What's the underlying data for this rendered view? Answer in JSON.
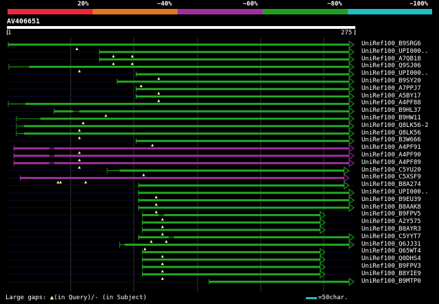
{
  "scale": {
    "labels": [
      "20%",
      "~40%",
      "~60%",
      "~80%",
      "~100%"
    ],
    "colors": [
      "#e8283c",
      "#e07820",
      "#a030a0",
      "#20a020",
      "#20c0c0"
    ]
  },
  "query": {
    "id": "AV406651",
    "start": "1",
    "end": "275"
  },
  "colors": {
    "green": "#22aa22",
    "purple": "#a030a0",
    "gap": "#22aa22",
    "triangle": "#ffffaa",
    "background": "#000000"
  },
  "hits": [
    {
      "label": "UniRef100_B9SRG6",
      "color": "green",
      "start": 0.5,
      "end": 275,
      "gaps": [
        55
      ]
    },
    {
      "label": "UniRef100_UPI000..",
      "color": "green",
      "start": 73,
      "end": 275,
      "gaps": [
        84,
        99
      ]
    },
    {
      "label": "UniRef100_A7QB18",
      "color": "green",
      "start": 73,
      "end": 275,
      "gaps": [
        84,
        99
      ]
    },
    {
      "label": "UniRef100_Q9SJ06",
      "color": "green",
      "start": 1,
      "end": 275,
      "thin": [
        [
          1,
          17
        ]
      ],
      "gaps": [
        57
      ]
    },
    {
      "label": "UniRef100_UPI000..",
      "color": "green",
      "start": 102,
      "end": 275,
      "gaps": [
        120
      ]
    },
    {
      "label": "UniRef100_B9SY20",
      "color": "green",
      "start": 87,
      "end": 275,
      "gaps": [
        106
      ]
    },
    {
      "label": "UniRef100_A7PPJ7",
      "color": "green",
      "start": 102,
      "end": 275,
      "gaps": [
        120
      ]
    },
    {
      "label": "UniRef100_A5BY17",
      "color": "green",
      "start": 102,
      "end": 275,
      "gaps": [
        120
      ]
    },
    {
      "label": "UniRef100_A4PF88",
      "color": "green",
      "start": 0.5,
      "end": 275,
      "thin": [
        [
          0.5,
          14
        ]
      ],
      "gaps": []
    },
    {
      "label": "UniRef100_B9HL37",
      "color": "green",
      "start": 37,
      "end": 275,
      "thin": [
        [
          52,
          57
        ]
      ],
      "gaps": [
        78
      ]
    },
    {
      "label": "UniRef100_B9HW11",
      "color": "green",
      "start": 7,
      "end": 275,
      "thin": [
        [
          7,
          26
        ]
      ],
      "gaps": [
        60
      ]
    },
    {
      "label": "UniRef100_Q8LK56-2",
      "color": "green",
      "start": 7,
      "end": 275,
      "thin": [
        [
          7,
          13
        ]
      ],
      "gaps": [
        57
      ]
    },
    {
      "label": "UniRef100_Q8LK56",
      "color": "green",
      "start": 7,
      "end": 275,
      "thin": [
        [
          7,
          13
        ]
      ],
      "gaps": [
        57
      ]
    },
    {
      "label": "UniRef100_B3W666",
      "color": "green",
      "start": 102,
      "end": 275,
      "gaps": [
        115
      ]
    },
    {
      "label": "UniRef100_A4PF91",
      "color": "purple",
      "start": 5,
      "end": 275,
      "thin": [
        [
          33,
          37
        ]
      ],
      "gaps": [
        57
      ]
    },
    {
      "label": "UniRef100_A4PF90",
      "color": "purple",
      "start": 5,
      "end": 275,
      "thin": [
        [
          33,
          37
        ]
      ],
      "gaps": [
        57
      ]
    },
    {
      "label": "UniRef100_A4PF89",
      "color": "purple",
      "start": 5,
      "end": 275,
      "thin": [
        [
          33,
          37
        ]
      ],
      "gaps": [
        57
      ]
    },
    {
      "label": "UniRef100_C5YU20",
      "color": "green",
      "start": 79,
      "end": 271,
      "thin": [
        [
          79,
          89
        ]
      ],
      "gaps": [
        108
      ]
    },
    {
      "label": "UniRef100_C5XSF9",
      "color": "purple",
      "start": 10,
      "end": 271,
      "gaps": [
        40,
        42,
        62
      ]
    },
    {
      "label": "UniRef100_B8A274",
      "color": "green",
      "start": 104,
      "end": 271,
      "gaps": []
    },
    {
      "label": "UniRef100_UPI000..",
      "color": "green",
      "start": 104,
      "end": 275,
      "gaps": [
        118
      ]
    },
    {
      "label": "UniRef100_B9EU39",
      "color": "green",
      "start": 104,
      "end": 275,
      "gaps": [
        118
      ]
    },
    {
      "label": "UniRef100_B8AAK8",
      "color": "green",
      "start": 104,
      "end": 275,
      "gaps": [
        118
      ]
    },
    {
      "label": "UniRef100_B9FPV5",
      "color": "green",
      "start": 107,
      "end": 252,
      "thin": [
        [
          120,
          124
        ]
      ],
      "gaps": [
        123
      ]
    },
    {
      "label": "UniRef100_A2Y575",
      "color": "green",
      "start": 107,
      "end": 252,
      "gaps": [
        123
      ]
    },
    {
      "label": "UniRef100_B8AYR3",
      "color": "green",
      "start": 107,
      "end": 252,
      "gaps": [
        123
      ]
    },
    {
      "label": "UniRef100_C5YYT7",
      "color": "green",
      "start": 104,
      "end": 275,
      "thin": [
        [
          128,
          132
        ]
      ],
      "gaps": [
        114,
        126
      ]
    },
    {
      "label": "UniRef100_Q6JJ31",
      "color": "green",
      "start": 89,
      "end": 275,
      "thin": [
        [
          89,
          93
        ]
      ],
      "gaps": [
        109
      ]
    },
    {
      "label": "UniRef100_Q65WT4",
      "color": "green",
      "start": 107,
      "end": 252,
      "gaps": [
        123
      ]
    },
    {
      "label": "UniRef100_Q0DHS4",
      "color": "green",
      "start": 107,
      "end": 252,
      "gaps": [
        123
      ]
    },
    {
      "label": "UniRef100_B9FPV3",
      "color": "green",
      "start": 107,
      "end": 252,
      "gaps": [
        123
      ]
    },
    {
      "label": "UniRef100_B8YIE9",
      "color": "green",
      "start": 107,
      "end": 252,
      "gaps": [
        123
      ]
    },
    {
      "label": "UniRef100_B9MTP0",
      "color": "green",
      "start": 160,
      "end": 275,
      "gaps": []
    }
  ],
  "footer": {
    "gaps_prefix": "Large gaps: ",
    "gaps_triangle": "▲",
    "gaps_suffix": "(in Query)/- (in Subject)",
    "scale_text": "=50char."
  }
}
